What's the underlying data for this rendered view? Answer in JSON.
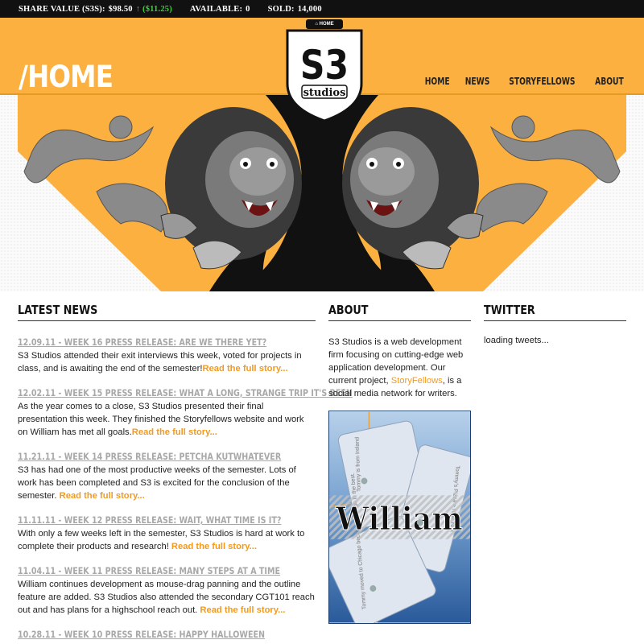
{
  "ticker": {
    "share_label": "SHARE VALUE (S3S):",
    "share_value": "$98.50",
    "share_change": "↑ ($11.25)",
    "available_label": "AVAILABLE:",
    "available_value": "0",
    "sold_label": "SOLD:",
    "sold_value": "14,000"
  },
  "header": {
    "page_title": "/HOME",
    "home_pill": "HOME",
    "logo_text": "S3",
    "logo_sub": "studios"
  },
  "nav": {
    "items": [
      {
        "label": "HOME"
      },
      {
        "label": "NEWS"
      },
      {
        "label": "STORYFELLOWS"
      },
      {
        "label": "ABOUT"
      }
    ]
  },
  "colors": {
    "accent": "#fbb040",
    "link": "#f39a1e",
    "title_gray": "#a8a8a8",
    "ticker_bg": "#111111",
    "up": "#3ecf3e"
  },
  "news": {
    "heading": "LATEST NEWS",
    "items": [
      {
        "title": "12.09.11 - WEEK 16 PRESS RELEASE: ARE WE THERE YET?",
        "body": "S3 Studios attended their exit interviews this week, voted for projects in class, and is awaiting the end of the semester!",
        "link": "Read the full story..."
      },
      {
        "title": "12.02.11 - WEEK 15 PRESS RELEASE: WHAT A LONG, STRANGE TRIP IT'S BEEN",
        "body": "As the year comes to a close, S3 Studios presented their final presentation this week. They finished the Storyfellows website and work on William has met all goals.",
        "link": "Read the full story..."
      },
      {
        "title": "11.21.11 - WEEK 14 PRESS RELEASE: PETCHA KUTWHATEVER",
        "body": "S3 has had one of the most productive weeks of the semester. Lots of work has been completed and S3 is excited for the conclusion of the semester.",
        "link": "Read the full story..."
      },
      {
        "title": "11.11.11 - WEEK 12 PRESS RELEASE: WAIT, WHAT TIME IS IT?",
        "body": "With only a few weeks left in the semester, S3 Studios is hard at work to complete their products and research!",
        "link": "Read the full story..."
      },
      {
        "title": "11.04.11 - WEEK 11 PRESS RELEASE: MANY STEPS AT A TIME",
        "body": "William continues development as mouse-drag panning and the outline feature are added. S3 Studios also attended the secondary CGT101 reach out and has plans for a highschool reach out.",
        "link": "Read the full story..."
      },
      {
        "title": "10.28.11 - WEEK 10 PRESS RELEASE: HAPPY HALLOWEEN",
        "body": "",
        "link": ""
      }
    ]
  },
  "about": {
    "heading": "ABOUT",
    "text_before": "S3 Studios is a web development firm focusing on cutting-edge web application development. Our current project, ",
    "link": "StoryFellows",
    "text_after": ", is a social media network for writers.",
    "promo": {
      "title": "William",
      "card1": "Tommy is from Ireland",
      "card2": "Tommy's Pizza > New York",
      "card3": "Tommy moved to Chicago because Chicago is the best."
    }
  },
  "twitter": {
    "heading": "TWITTER",
    "status": "loading tweets..."
  }
}
